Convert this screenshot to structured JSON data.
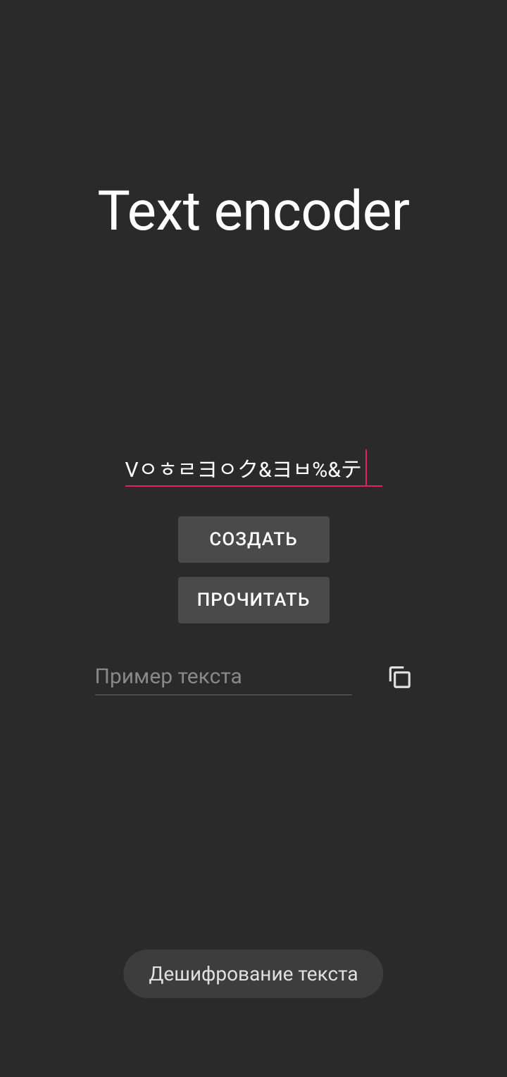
{
  "app": {
    "title": "Text encoder"
  },
  "inputs": {
    "encoded_text": "Vㅇㅎㄹヨㅇク&ヨㅂ%&テ",
    "example_placeholder": "Пример текста"
  },
  "buttons": {
    "create": "СОЗДАТЬ",
    "read": "ПРОЧИТАТЬ"
  },
  "toast": {
    "message": "Дешифрование текста"
  }
}
